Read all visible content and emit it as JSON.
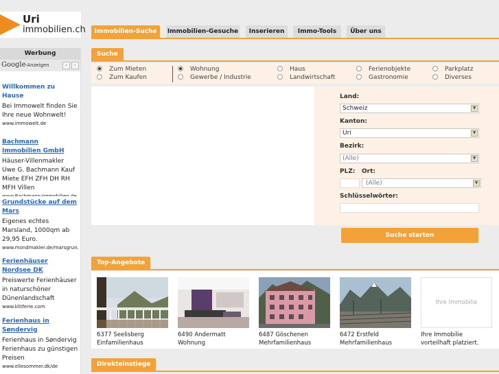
{
  "logo": {
    "line1": "Uri",
    "line2": "immobilien.ch"
  },
  "nav": {
    "tabs": [
      {
        "label": "Immobilien-Suche",
        "active": true
      },
      {
        "label": "Immobilien-Gesuche",
        "active": false
      },
      {
        "label": "Inserieren",
        "active": false
      },
      {
        "label": "Immo-Tools",
        "active": false
      },
      {
        "label": "Über uns",
        "active": false
      }
    ]
  },
  "sidebar": {
    "heading": "Werbung",
    "google": {
      "logo": "Google",
      "label": "-Anzeigen",
      "prev": "‹",
      "next": "›"
    },
    "ads": [
      {
        "title": "Willkommen zu Hause",
        "text": "Bei Immowelt finden Sie Ihre neue Wohnwelt!",
        "url": "www.immowelt.de"
      },
      {
        "title": "Bachmann Immobilien GmbH",
        "text": "Häuser-Villenmakler Uwe G. Bachmann Kauf Miete EFH ZFH DH RH MFH Villen",
        "url": "www.Bachmann-Immobilien.de"
      },
      {
        "title": "Grundstücke auf dem Mars",
        "text": "Eigenes echtes Marsland, 1000qm ab 29,95 Euro.",
        "url": "www.mondmakler.de/marsgrun…"
      },
      {
        "title": "Ferienhäuser Nordsee DK",
        "text": "Preiswerte Ferienhäuser in naturschöner Dünenlandschaft",
        "url": "www.klitferie.com"
      },
      {
        "title": "Ferienhaus in Søndervig",
        "text": "Ferienhaus in Søndervig Ferienhaus zu günstigen Preisen",
        "url": "www.ellesommer.dk/de"
      }
    ]
  },
  "search": {
    "heading": "Suche",
    "mode": [
      {
        "label": "Zum Mieten",
        "checked": true
      },
      {
        "label": "Zum Kaufen",
        "checked": false
      }
    ],
    "categories": [
      {
        "label": "Wohnung",
        "checked": true
      },
      {
        "label": "Gewerbe / Industrie",
        "checked": false
      },
      {
        "label": "Haus",
        "checked": false
      },
      {
        "label": "Landwirtschaft",
        "checked": false
      },
      {
        "label": "Ferienobjekte",
        "checked": false
      },
      {
        "label": "Gastronomie",
        "checked": false
      },
      {
        "label": "Parkplatz",
        "checked": false
      },
      {
        "label": "Diverses",
        "checked": false
      }
    ],
    "form": {
      "land_label": "Land:",
      "land_value": "Schweiz",
      "kanton_label": "Kanton:",
      "kanton_value": "Uri",
      "bezirk_label": "Bezirk:",
      "bezirk_value": "(Alle)",
      "plz_label": "PLZ:",
      "ort_label": "Ort:",
      "plz_value": "",
      "ort_value": "(Alle)",
      "keywords_label": "Schlüsselwörter:",
      "keywords_value": ""
    },
    "submit": "Suche starten"
  },
  "offers": {
    "heading": "Top-Angebote",
    "items": [
      {
        "line1": "6377 Seelisberg",
        "line2": "Einfamilienhaus",
        "image": "balcony-mountain-photo"
      },
      {
        "line1": "6490 Andermatt",
        "line2": "Wohnung",
        "image": "interior-living-room-photo"
      },
      {
        "line1": "6487 Göschenen",
        "line2": "Mehrfamilienhaus",
        "image": "pink-building-photo"
      },
      {
        "line1": "6472 Erstfeld",
        "line2": "Mehrfamilienhaus",
        "image": "railway-valley-photo"
      },
      {
        "line1": "Ihre Immobilie",
        "line2": "vorteilhaft platziert.",
        "placeholder": "Ihre Immobilie"
      }
    ]
  },
  "direct": {
    "heading": "Direkteinstiege"
  }
}
